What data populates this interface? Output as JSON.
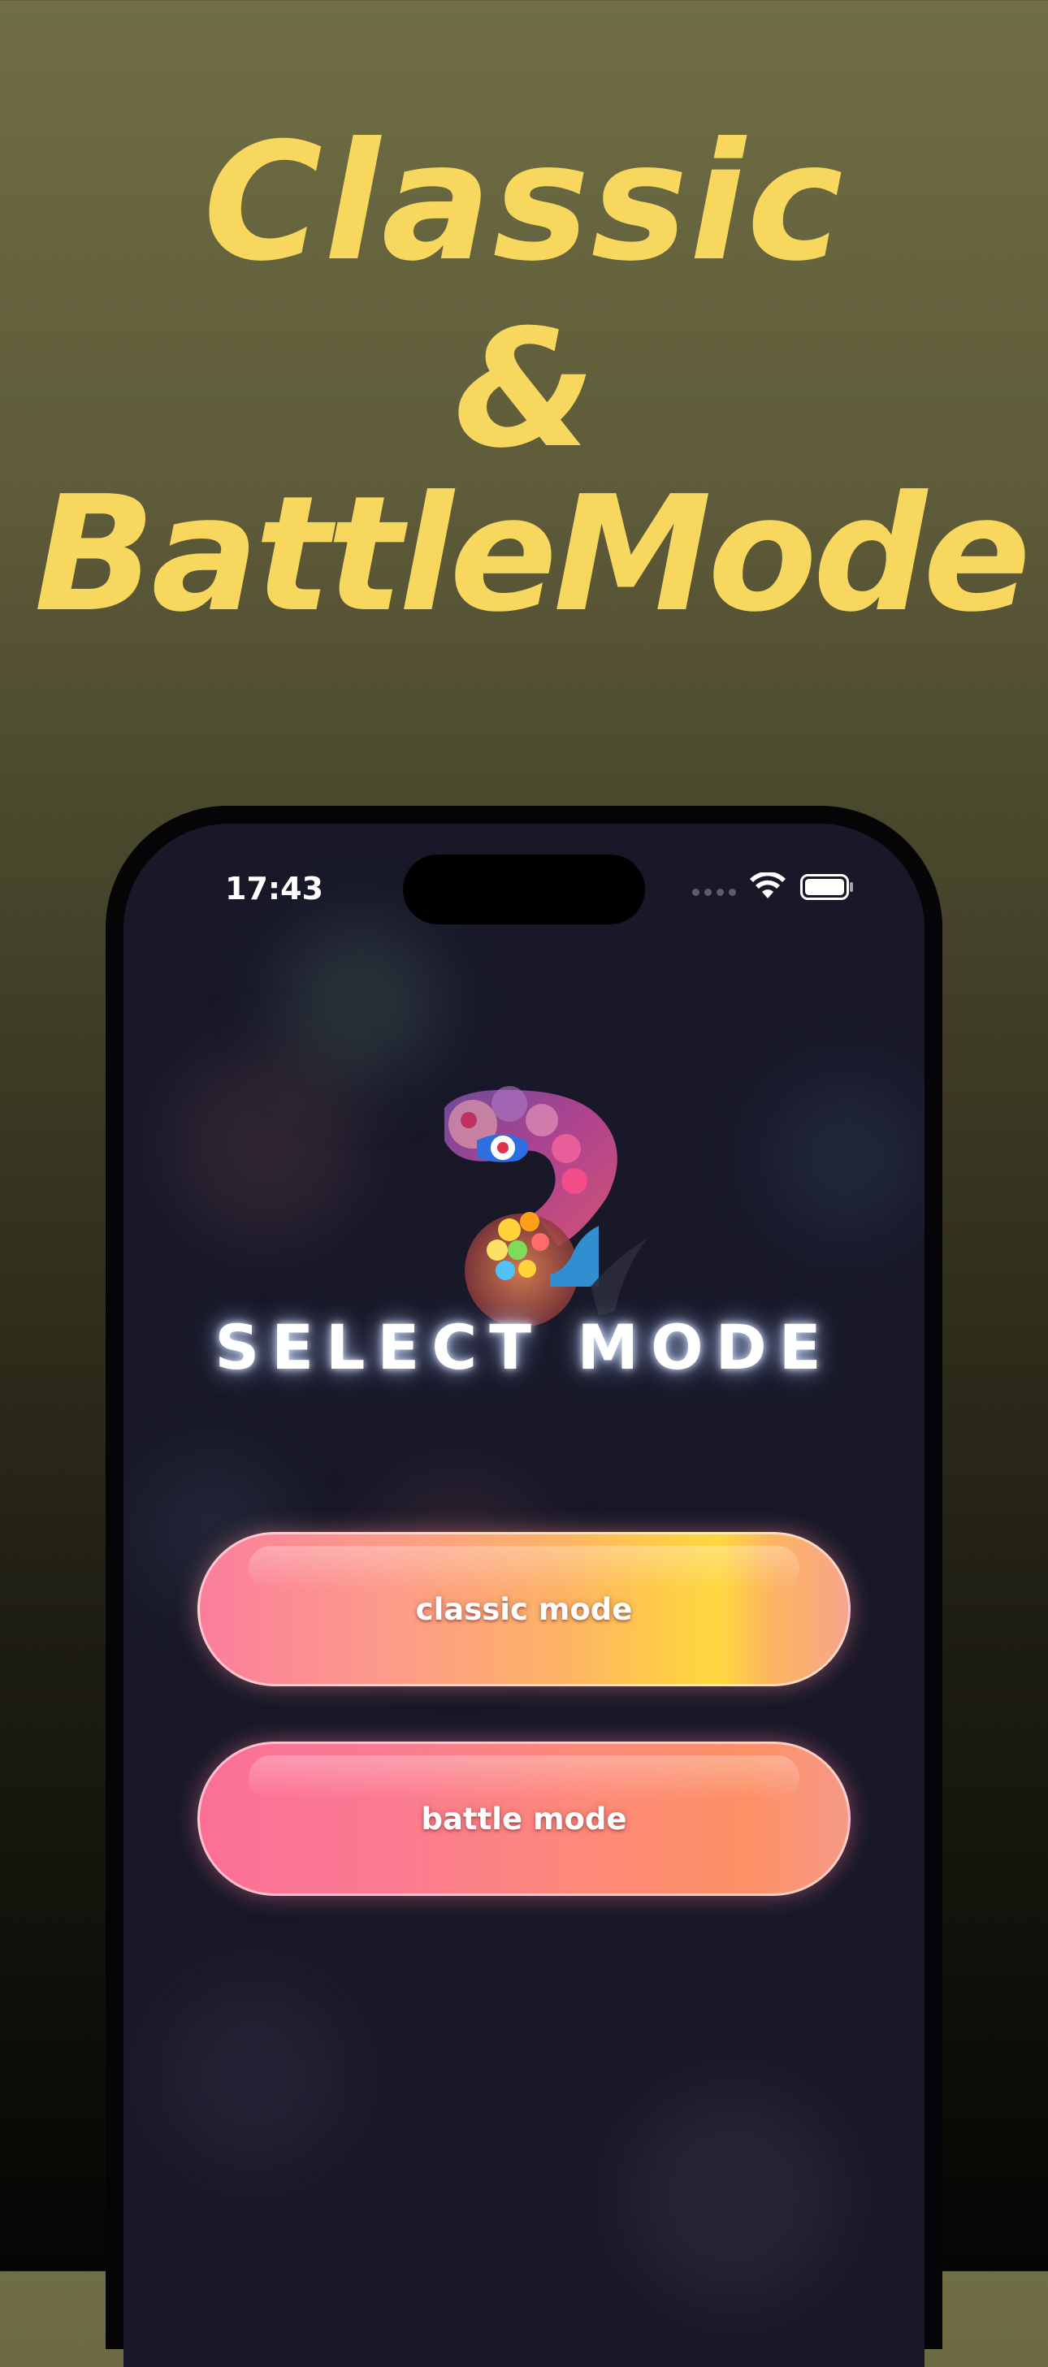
{
  "promo": {
    "line1": "Classic",
    "line2": "&",
    "line3": "BattleMode",
    "color": "#f7d75e"
  },
  "status_bar": {
    "time": "17:43",
    "icons": [
      "cellular-signal-icon",
      "wifi-icon",
      "battery-icon"
    ]
  },
  "app": {
    "logo_icon": "chameleon-logo-icon",
    "title": "SELECT MODE",
    "buttons": {
      "classic": "classic mode",
      "battle": "battle mode"
    }
  }
}
